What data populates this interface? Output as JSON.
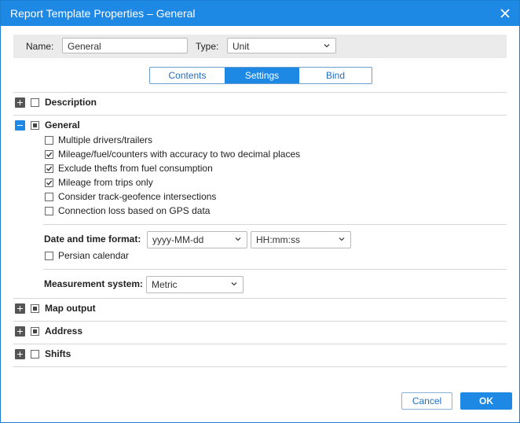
{
  "window": {
    "title": "Report Template Properties – General",
    "close_icon": "close-icon"
  },
  "name_field": {
    "label": "Name:",
    "value": "General"
  },
  "type_field": {
    "label": "Type:",
    "value": "Unit"
  },
  "tabs": [
    {
      "label": "Contents",
      "active": false
    },
    {
      "label": "Settings",
      "active": true
    },
    {
      "label": "Bind",
      "active": false
    }
  ],
  "sections": {
    "description": {
      "label": "Description",
      "expanded": false,
      "checkbox": "unchecked"
    },
    "general": {
      "label": "General",
      "expanded": true,
      "checkbox": "partial"
    },
    "map_output": {
      "label": "Map output",
      "expanded": false,
      "checkbox": "partial"
    },
    "address": {
      "label": "Address",
      "expanded": false,
      "checkbox": "partial"
    },
    "shifts": {
      "label": "Shifts",
      "expanded": false,
      "checkbox": "unchecked"
    }
  },
  "general_options": [
    {
      "label": "Multiple drivers/trailers",
      "checked": false
    },
    {
      "label": "Mileage/fuel/counters with accuracy to two decimal places",
      "checked": true
    },
    {
      "label": "Exclude thefts from fuel consumption",
      "checked": true
    },
    {
      "label": "Mileage from trips only",
      "checked": true
    },
    {
      "label": "Consider track-geofence intersections",
      "checked": false
    },
    {
      "label": "Connection loss based on GPS data",
      "checked": false
    }
  ],
  "datetime": {
    "label": "Date and time format:",
    "date_value": "yyyy-MM-dd",
    "time_value": "HH:mm:ss",
    "persian_label": "Persian calendar",
    "persian_checked": false
  },
  "measurement": {
    "label": "Measurement system:",
    "value": "Metric"
  },
  "buttons": {
    "cancel": "Cancel",
    "ok": "OK"
  },
  "colors": {
    "accent": "#1e88e5",
    "border": "#d6d6d6"
  }
}
